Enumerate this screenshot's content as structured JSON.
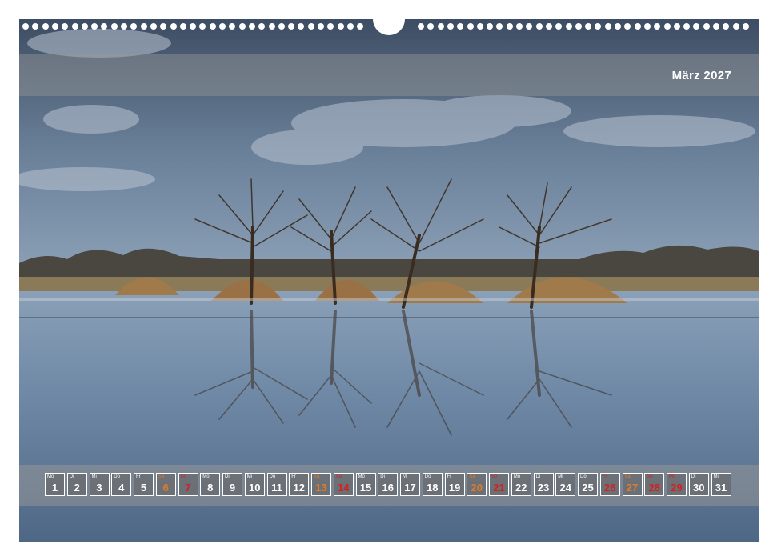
{
  "calendar": {
    "month_title": "März 2027",
    "days": [
      {
        "wd": "Mo",
        "d": "1",
        "kind": "weekday"
      },
      {
        "wd": "Di",
        "d": "2",
        "kind": "weekday"
      },
      {
        "wd": "Mi",
        "d": "3",
        "kind": "weekday"
      },
      {
        "wd": "Do",
        "d": "4",
        "kind": "weekday"
      },
      {
        "wd": "Fr",
        "d": "5",
        "kind": "weekday"
      },
      {
        "wd": "Sa",
        "d": "6",
        "kind": "sat"
      },
      {
        "wd": "So",
        "d": "7",
        "kind": "sun"
      },
      {
        "wd": "Mo",
        "d": "8",
        "kind": "weekday"
      },
      {
        "wd": "Di",
        "d": "9",
        "kind": "weekday"
      },
      {
        "wd": "Mi",
        "d": "10",
        "kind": "weekday"
      },
      {
        "wd": "Do",
        "d": "11",
        "kind": "weekday"
      },
      {
        "wd": "Fr",
        "d": "12",
        "kind": "weekday"
      },
      {
        "wd": "Sa",
        "d": "13",
        "kind": "sat"
      },
      {
        "wd": "So",
        "d": "14",
        "kind": "sun"
      },
      {
        "wd": "Mo",
        "d": "15",
        "kind": "weekday"
      },
      {
        "wd": "Di",
        "d": "16",
        "kind": "weekday"
      },
      {
        "wd": "Mi",
        "d": "17",
        "kind": "weekday"
      },
      {
        "wd": "Do",
        "d": "18",
        "kind": "weekday"
      },
      {
        "wd": "Fr",
        "d": "19",
        "kind": "weekday"
      },
      {
        "wd": "Sa",
        "d": "20",
        "kind": "sat"
      },
      {
        "wd": "So",
        "d": "21",
        "kind": "sun"
      },
      {
        "wd": "Mo",
        "d": "22",
        "kind": "weekday"
      },
      {
        "wd": "Di",
        "d": "23",
        "kind": "weekday"
      },
      {
        "wd": "Mi",
        "d": "24",
        "kind": "weekday"
      },
      {
        "wd": "Do",
        "d": "25",
        "kind": "weekday"
      },
      {
        "wd": "Fr",
        "d": "26",
        "kind": "sun"
      },
      {
        "wd": "Sa",
        "d": "27",
        "kind": "sat"
      },
      {
        "wd": "So",
        "d": "28",
        "kind": "sun"
      },
      {
        "wd": "Mo",
        "d": "29",
        "kind": "sun"
      },
      {
        "wd": "Di",
        "d": "30",
        "kind": "weekday"
      },
      {
        "wd": "Mi",
        "d": "31",
        "kind": "weekday"
      }
    ]
  },
  "colors": {
    "saturday": "#e07a2a",
    "sunday_holiday": "#d61f1f",
    "band": "#969696"
  }
}
